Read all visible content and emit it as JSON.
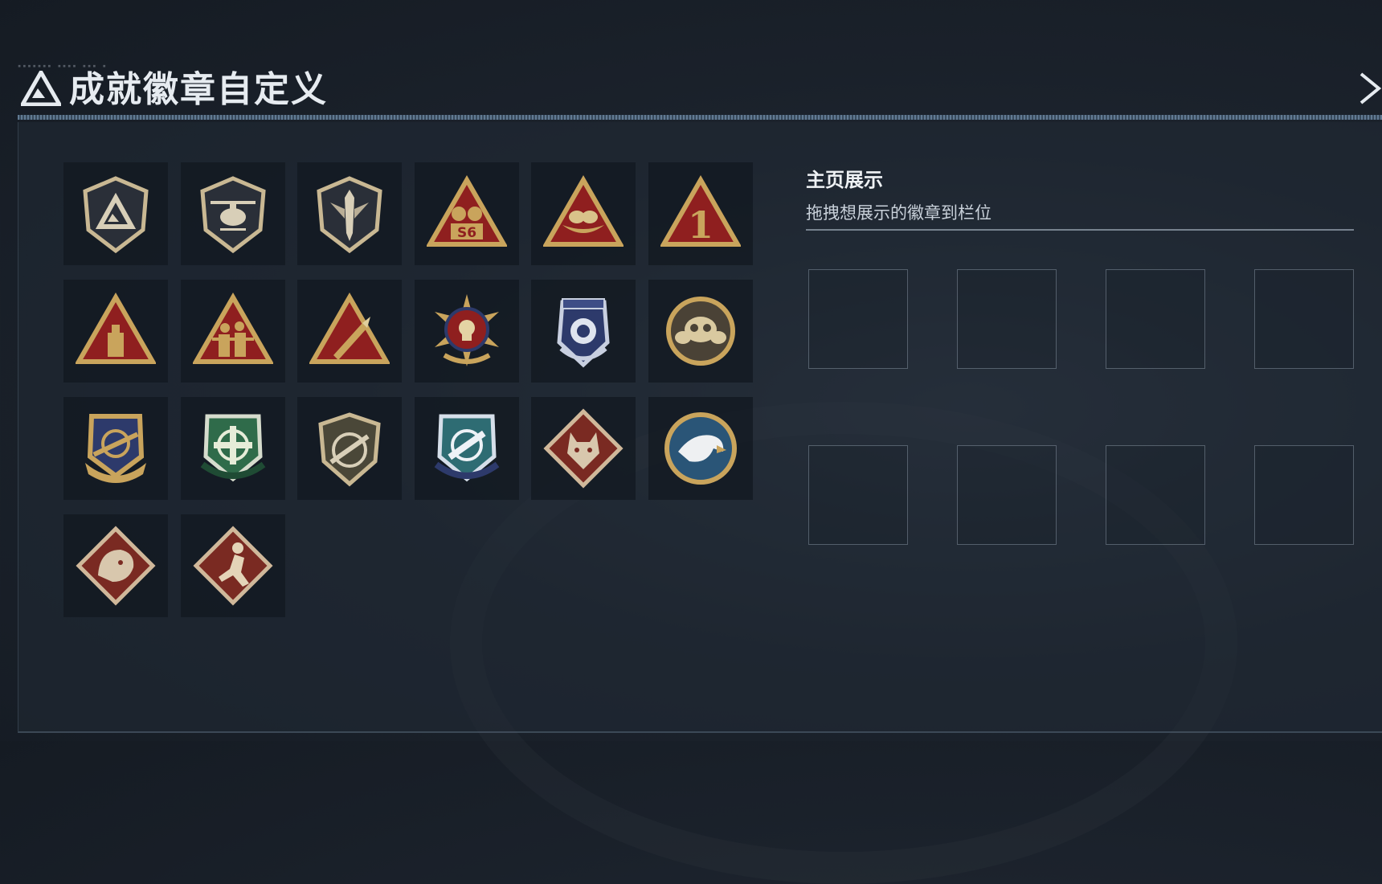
{
  "header": {
    "title": "成就徽章自定义",
    "logo_icon": "delta-logo-icon",
    "close_icon": "close-icon"
  },
  "showcase": {
    "title": "主页展示",
    "subtitle": "拖拽想展示的徽章到栏位",
    "slot_count": 8
  },
  "badges": [
    {
      "name": "delta-shield-badge",
      "label": ""
    },
    {
      "name": "helicopter-shield-badge",
      "label": ""
    },
    {
      "name": "dagger-shield-badge",
      "label": ""
    },
    {
      "name": "s6-triangle-badge",
      "label": "S6"
    },
    {
      "name": "nest-triangle-badge",
      "label": ""
    },
    {
      "name": "number-one-triangle-badge",
      "label": "1"
    },
    {
      "name": "tower-triangle-badge",
      "label": ""
    },
    {
      "name": "soldiers-triangle-badge",
      "label": ""
    },
    {
      "name": "rocket-triangle-badge",
      "label": ""
    },
    {
      "name": "skull-star-badge",
      "label": ""
    },
    {
      "name": "police-crest-badge",
      "label": ""
    },
    {
      "name": "skull-helmet-badge",
      "label": ""
    },
    {
      "name": "gold-rifle-crest-badge",
      "label": ""
    },
    {
      "name": "green-crosshair-crest-badge",
      "label": ""
    },
    {
      "name": "sniper-shield-badge",
      "label": ""
    },
    {
      "name": "blue-crosshair-crest-badge",
      "label": ""
    },
    {
      "name": "wolf-diamond-badge",
      "label": ""
    },
    {
      "name": "eagle-circle-badge",
      "label": ""
    },
    {
      "name": "dragon-diamond-badge",
      "label": ""
    },
    {
      "name": "runner-diamond-badge",
      "label": ""
    }
  ],
  "colors": {
    "accent": "#6e8aa5",
    "gold": "#c9a45c",
    "red": "#8f1f1f",
    "navy": "#2d3a6b",
    "green": "#2f6b4a"
  }
}
